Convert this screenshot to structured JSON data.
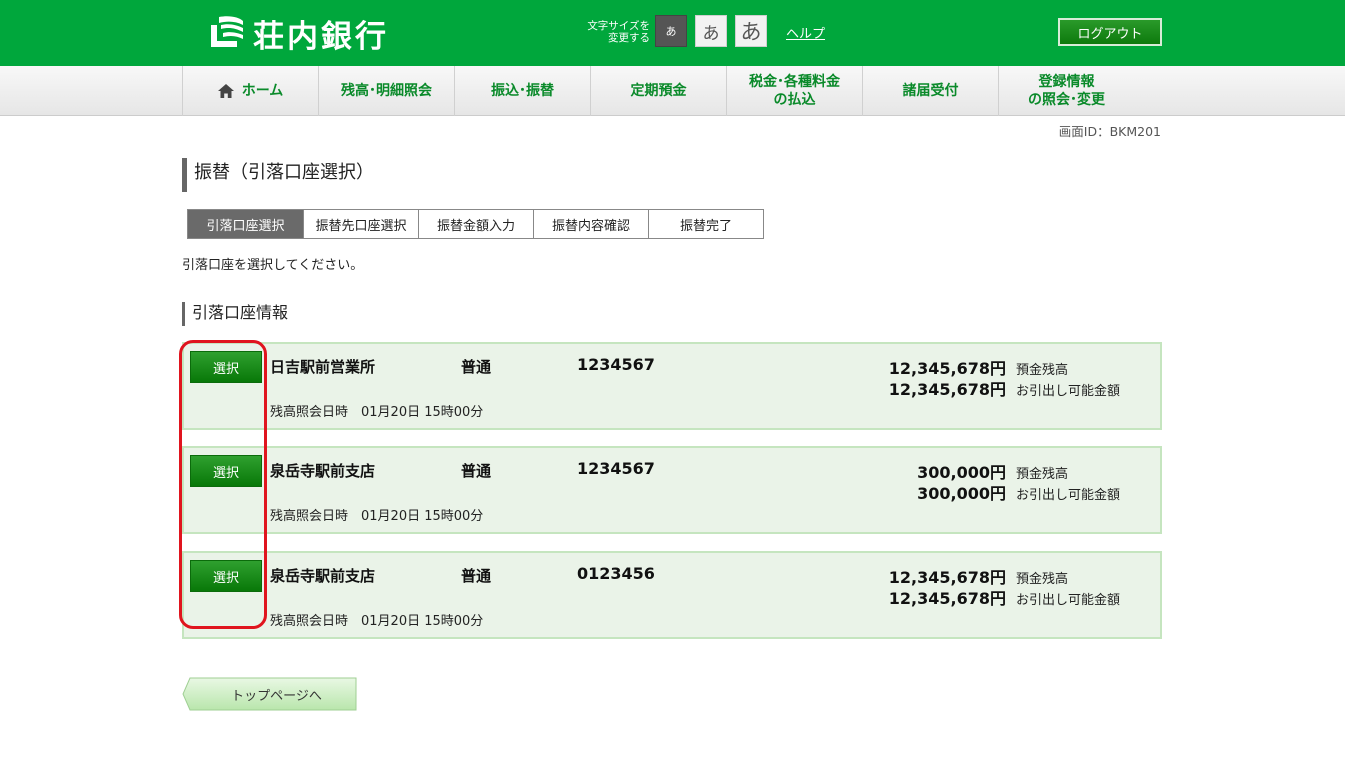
{
  "colors": {
    "brand": "#00a73c",
    "nav_text": "#0a8a2a",
    "card_bg": "#eaf3e8",
    "card_border": "#c5e5bf",
    "highlight": "#e0141e"
  },
  "header": {
    "bank_name": "荘内銀行",
    "font_size_label_line1": "文字サイズを",
    "font_size_label_line2": "変更する",
    "font_small": "あ",
    "font_medium": "あ",
    "font_large": "あ",
    "help": "ヘルプ",
    "logout": "ログアウト"
  },
  "nav": {
    "home": "ホーム",
    "balance": "残高･明細照会",
    "transfer": "振込･振替",
    "time_deposit": "定期預金",
    "tax_line1": "税金･各種料金",
    "tax_line2": "の払込",
    "notifications": "諸届受付",
    "registration_line1": "登録情報",
    "registration_line2": "の照会･変更"
  },
  "screen_id": "画面ID：BKM201",
  "page_title": "振替（引落口座選択）",
  "steps": [
    "引落口座選択",
    "振替先口座選択",
    "振替金額入力",
    "振替内容確認",
    "振替完了"
  ],
  "instruction": "引落口座を選択してください。",
  "section_title": "引落口座情報",
  "accounts": [
    {
      "select": "選択",
      "branch": "日吉駅前営業所",
      "type": "普通",
      "number": "1234567",
      "balance": "12,345,678円",
      "balance_label": "預金残高",
      "available": "12,345,678円",
      "available_label": "お引出し可能金額",
      "inquiry": "残高照会日時　01月20日 15時00分"
    },
    {
      "select": "選択",
      "branch": "泉岳寺駅前支店",
      "type": "普通",
      "number": "1234567",
      "balance": "300,000円",
      "balance_label": "預金残高",
      "available": "300,000円",
      "available_label": "お引出し可能金額",
      "inquiry": "残高照会日時　01月20日 15時00分"
    },
    {
      "select": "選択",
      "branch": "泉岳寺駅前支店",
      "type": "普通",
      "number": "0123456",
      "balance": "12,345,678円",
      "balance_label": "預金残高",
      "available": "12,345,678円",
      "available_label": "お引出し可能金額",
      "inquiry": "残高照会日時　01月20日 15時00分"
    }
  ],
  "back_button": "トップページへ"
}
